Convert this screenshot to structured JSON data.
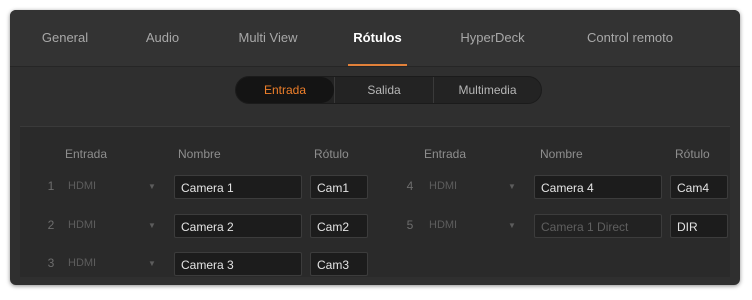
{
  "tabs": [
    {
      "label": "General"
    },
    {
      "label": "Audio"
    },
    {
      "label": "Multi View"
    },
    {
      "label": "Rótulos"
    },
    {
      "label": "HyperDeck"
    },
    {
      "label": "Control remoto"
    }
  ],
  "active_tab": "Rótulos",
  "segments": [
    {
      "label": "Entrada"
    },
    {
      "label": "Salida"
    },
    {
      "label": "Multimedia"
    }
  ],
  "active_segment": "Entrada",
  "headers": {
    "entrada": "Entrada",
    "nombre": "Nombre",
    "rotulo": "Rótulo"
  },
  "rows": [
    {
      "num": "1",
      "source": "HDMI",
      "name": "Camera 1",
      "label": "Cam1"
    },
    {
      "num": "2",
      "source": "HDMI",
      "name": "Camera 2",
      "label": "Cam2"
    },
    {
      "num": "3",
      "source": "HDMI",
      "name": "Camera 3",
      "label": "Cam3"
    },
    {
      "num": "4",
      "source": "HDMI",
      "name": "Camera 4",
      "label": "Cam4"
    },
    {
      "num": "5",
      "source": "HDMI",
      "name": "",
      "name_placeholder": "Camera 1 Direct",
      "label": "DIR"
    }
  ],
  "icons": {
    "dropdown": "chevron-down-icon"
  },
  "colors": {
    "accent": "#e2813a",
    "background": "#2f2f2f"
  }
}
